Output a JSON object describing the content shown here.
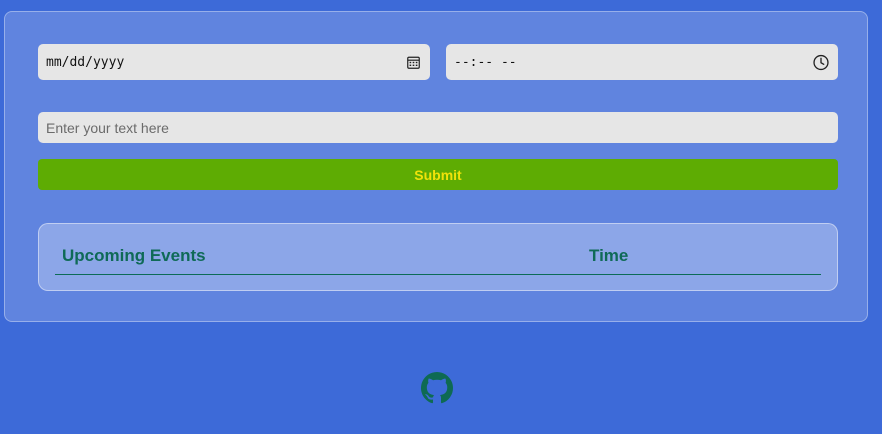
{
  "form": {
    "date_placeholder": "mm/dd/yyyy",
    "time_placeholder": "--:-- --",
    "text_placeholder": "Enter your text here",
    "text_value": "",
    "submit_label": "Submit"
  },
  "events_table": {
    "columns": [
      "Upcoming Events",
      "Time"
    ],
    "rows": []
  },
  "footer": {
    "link_icon": "github-icon"
  },
  "colors": {
    "background": "#3d6ad8",
    "submit_bg": "#5eac03",
    "submit_text": "#f0e20a",
    "header_text": "#0f6a57",
    "github_icon": "#0e6a53"
  },
  "icons": {
    "date": "calendar-icon",
    "time": "clock-icon"
  }
}
